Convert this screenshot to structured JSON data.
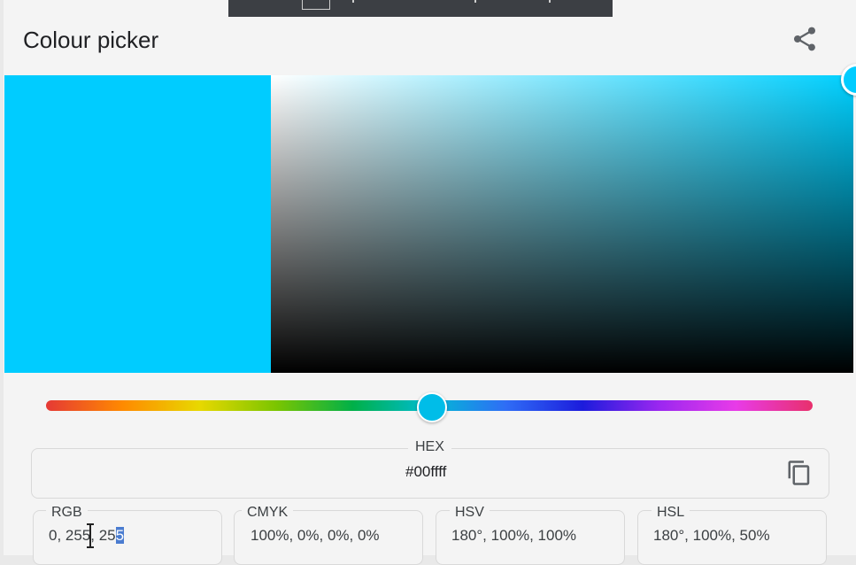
{
  "header": {
    "title": "Colour picker",
    "share_icon": "share-icon"
  },
  "colors": {
    "current": "#00ccff",
    "swatch": "#00ccff"
  },
  "hue_slider": {
    "value_fraction": 0.5
  },
  "hex": {
    "label": "HEX",
    "value": "#00ffff",
    "copy_icon": "copy-icon"
  },
  "models": [
    {
      "label": "RGB",
      "value_main": "0, 255, 25",
      "value_selected": "5"
    },
    {
      "label": "CMYK",
      "value": "100%, 0%, 0%, 0%"
    },
    {
      "label": "HSV",
      "value": "180°, 100%, 100%"
    },
    {
      "label": "HSL",
      "value": "180°, 100%, 50%"
    }
  ]
}
